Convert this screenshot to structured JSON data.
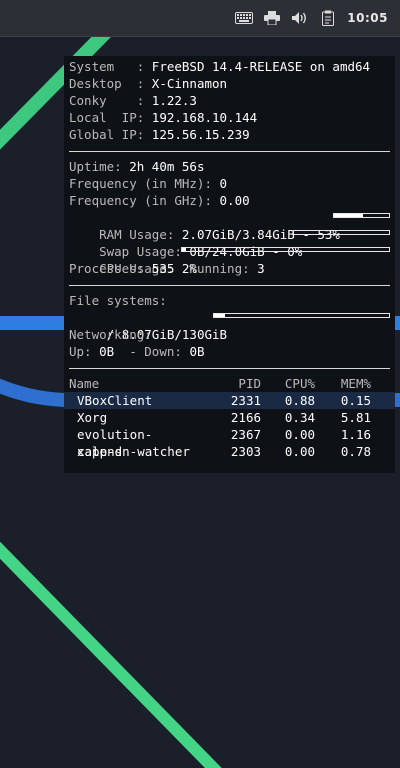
{
  "panel": {
    "clock": "10:05",
    "tray_icons": [
      "keyboard-icon",
      "printer-icon",
      "volume-icon",
      "clipboard-icon"
    ]
  },
  "conky": {
    "system": {
      "label": "System   : ",
      "value": "FreeBSD 14.4-RELEASE on amd64"
    },
    "desktop": {
      "label": "Desktop  : ",
      "value": "X-Cinnamon"
    },
    "conky_version": {
      "label": "Conky    : ",
      "value": "1.22.3"
    },
    "local_ip": {
      "label": "Local  IP: ",
      "value": "192.168.10.144"
    },
    "global_ip": {
      "label": "Global IP: ",
      "value": "125.56.15.239"
    },
    "uptime": {
      "label": "Uptime: ",
      "value": "2h 40m 56s"
    },
    "freq_mhz": {
      "label": "Frequency (in MHz): ",
      "value": "0"
    },
    "freq_ghz": {
      "label": "Frequency (in GHz): ",
      "value": "0.00"
    },
    "ram": {
      "label": "RAM Usage: ",
      "value": "2.07GiB/3.84GiB - 53%",
      "percent": 53
    },
    "swap": {
      "label": "Swap Usage: ",
      "value": "0B/24.0GiB - 0%",
      "percent": 0
    },
    "cpu": {
      "label": "CPU Usage: ",
      "value": "2%",
      "percent": 2
    },
    "processes": {
      "label": "Processes: ",
      "value": "535",
      "running_label": "  Running: ",
      "running_value": "3"
    },
    "filesystems": {
      "heading": "File systems:",
      "root": {
        "label": " / ",
        "value": "8.07GiB/130GiB",
        "percent": 6
      }
    },
    "networking": {
      "heading": "Networking:",
      "up_label": "Up: ",
      "up_value": "0B",
      "down_label": "  - Down: ",
      "down_value": "0B"
    },
    "process_table": {
      "headers": {
        "name": "Name",
        "pid": "PID",
        "cpu": "CPU%",
        "mem": "MEM%"
      },
      "rows": [
        {
          "name": "VBoxClient",
          "pid": "2331",
          "cpu": "0.88",
          "mem": "0.15"
        },
        {
          "name": "Xorg",
          "pid": "2166",
          "cpu": "0.34",
          "mem": "5.81"
        },
        {
          "name": "evolution-calend",
          "pid": "2367",
          "cpu": "0.00",
          "mem": "1.16"
        },
        {
          "name": "xapp-sn-watcher",
          "pid": "2303",
          "cpu": "0.00",
          "mem": "0.78"
        }
      ]
    }
  },
  "colors": {
    "wallpaper_bg": "#1b1f2a",
    "accent_green": "#3ec77f",
    "accent_blue": "#2f7de0",
    "conky_bg": "#0e1116",
    "highlight_row": "#1a2a45"
  }
}
